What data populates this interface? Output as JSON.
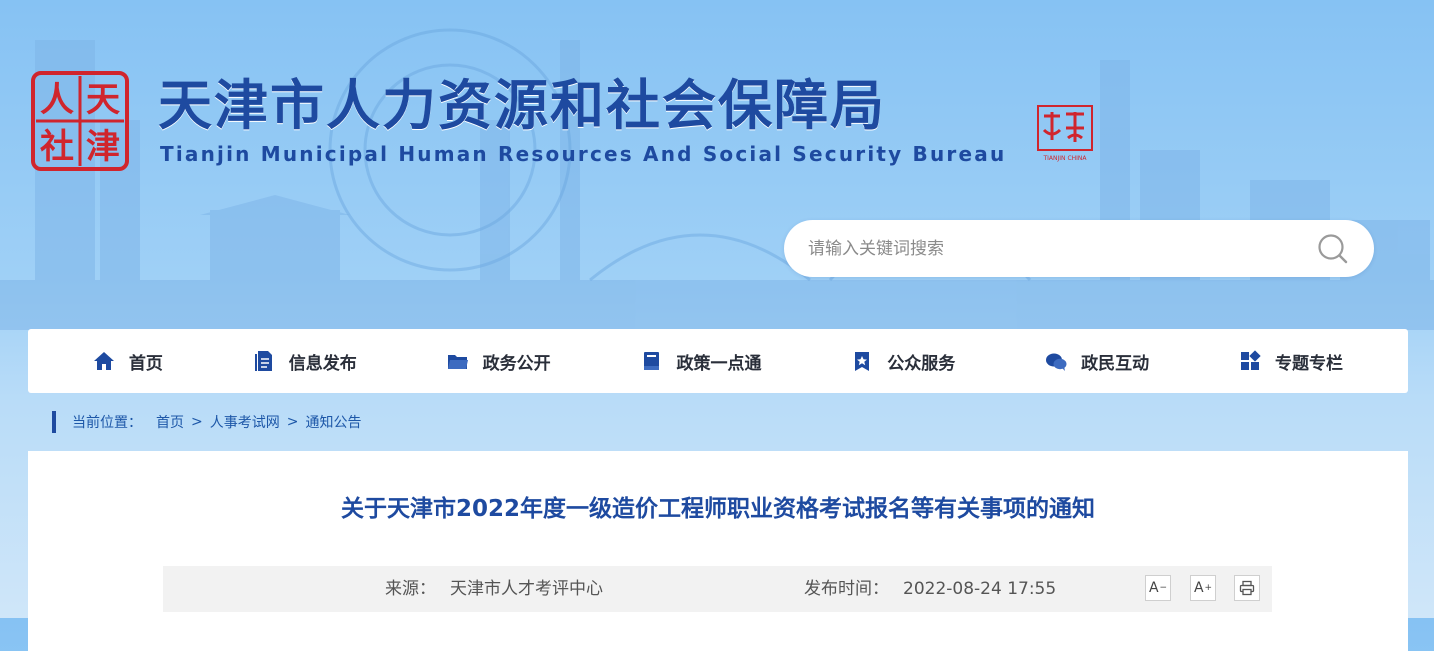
{
  "header": {
    "site_title_cn": "天津市人力资源和社会保障局",
    "site_title_en": "Tianjin Municipal Human Resources And Social Security Bureau",
    "logo_text": [
      "人",
      "天",
      "社",
      "津"
    ],
    "seal_text": "TIANJIN CHINA"
  },
  "search": {
    "placeholder": "请输入关键词搜索"
  },
  "nav": {
    "items": [
      {
        "label": "首页",
        "icon": "home-icon"
      },
      {
        "label": "信息发布",
        "icon": "document-icon"
      },
      {
        "label": "政务公开",
        "icon": "folder-icon"
      },
      {
        "label": "政策一点通",
        "icon": "book-icon"
      },
      {
        "label": "公众服务",
        "icon": "bookmark-star-icon"
      },
      {
        "label": "政民互动",
        "icon": "chat-icon"
      },
      {
        "label": "专题专栏",
        "icon": "grid-icon"
      }
    ]
  },
  "breadcrumb": {
    "prefix": "当前位置：",
    "items": [
      "首页",
      "人事考试网",
      "通知公告"
    ],
    "separator": ">"
  },
  "article": {
    "title": "关于天津市2022年度一级造价工程师职业资格考试报名等有关事项的通知",
    "source_label": "来源：",
    "source_value": "天津市人才考评中心",
    "time_label": "发布时间：",
    "time_value": "2022-08-24 17:55",
    "font_decrease": "A",
    "font_increase": "A"
  },
  "colors": {
    "brand_blue": "#1e4aa0",
    "link_blue": "#1d57a8",
    "seal_red": "#d0252d"
  }
}
